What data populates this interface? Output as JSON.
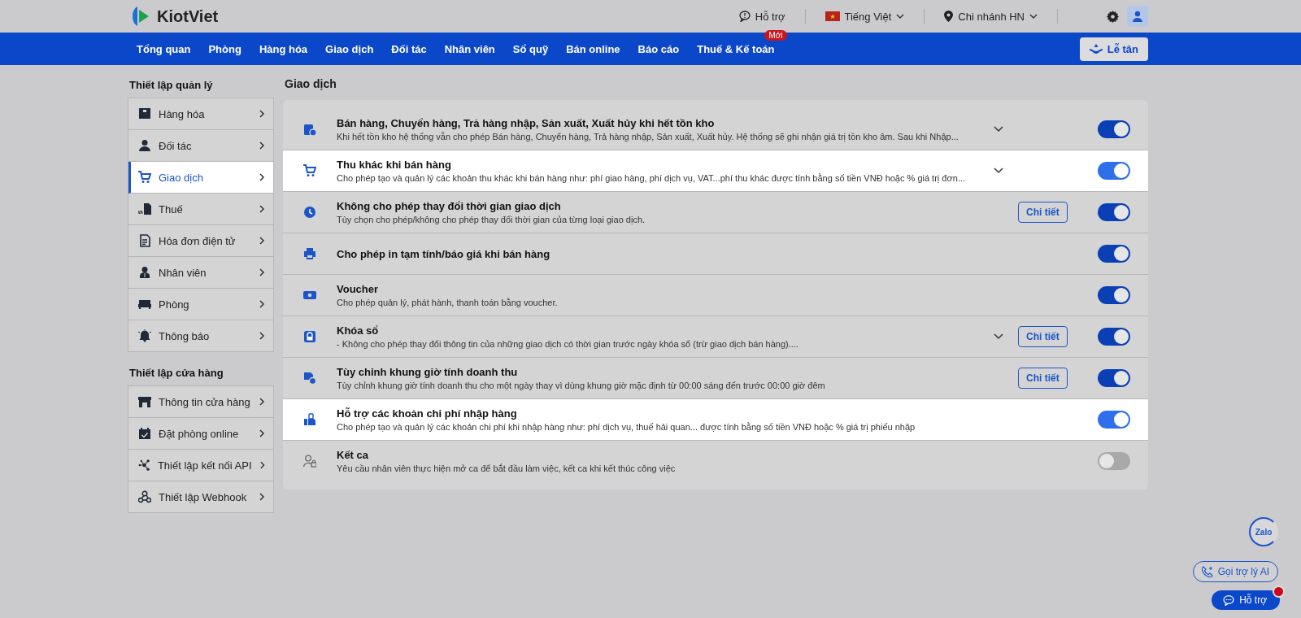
{
  "header": {
    "logo": "KiotViet",
    "support": "Hỗ trợ",
    "language": "Tiếng Việt",
    "branch": "Chi nhánh HN"
  },
  "nav": {
    "items": [
      {
        "label": "Tổng quan"
      },
      {
        "label": "Phòng"
      },
      {
        "label": "Hàng hóa"
      },
      {
        "label": "Giao dịch"
      },
      {
        "label": "Đối tác"
      },
      {
        "label": "Nhân viên"
      },
      {
        "label": "Sổ quỹ"
      },
      {
        "label": "Bán online"
      },
      {
        "label": "Báo cáo"
      },
      {
        "label": "Thuế & Kế toán",
        "badge": "Mới"
      }
    ],
    "reception_button": "Lễ tân"
  },
  "sidebar": {
    "groups": [
      {
        "title": "Thiết lập quản lý",
        "items": [
          {
            "label": "Hàng hóa",
            "selected": false
          },
          {
            "label": "Đối tác",
            "selected": false
          },
          {
            "label": "Giao dịch",
            "selected": true
          },
          {
            "label": "Thuế",
            "selected": false
          },
          {
            "label": "Hóa đơn điện tử",
            "selected": false
          },
          {
            "label": "Nhân viên",
            "selected": false
          },
          {
            "label": "Phòng",
            "selected": false
          },
          {
            "label": "Thông báo",
            "selected": false
          }
        ]
      },
      {
        "title": "Thiết lập cửa hàng",
        "items": [
          {
            "label": "Thông tin cửa hàng",
            "selected": false
          },
          {
            "label": "Đặt phòng online",
            "selected": false
          },
          {
            "label": "Thiết lập kết nối API",
            "selected": false
          },
          {
            "label": "Thiết lập Webhook",
            "selected": false
          }
        ]
      }
    ]
  },
  "settings": {
    "title": "Giao dịch",
    "rows": [
      {
        "title": "Bán hàng, Chuyển hàng, Trả hàng nhập, Sản xuất, Xuất hủy khi hết tồn kho",
        "description": "Khi hết tồn kho hệ thống vẫn cho phép Bán hàng, Chuyển hàng, Trả hàng nhập, Sản xuất, Xuất hủy. Hệ thống sẽ ghi nhận giá trị tồn kho âm. Sau khi Nhập...",
        "expandable": true,
        "on": true,
        "highlighted": false
      },
      {
        "title": "Thu khác khi bán hàng",
        "description": "Cho phép tạo và quản lý các khoản thu khác khi bán hàng như: phí giao hàng, phí dịch vụ, VAT...phí thu khác được tính bằng số tiền VNĐ hoặc % giá trị đơn...",
        "expandable": true,
        "on": true,
        "highlighted": true
      },
      {
        "title": "Không cho phép thay đổi thời gian giao dịch",
        "description": "Tùy chọn cho phép/không cho phép thay đổi thời gian của từng loại giao dịch.",
        "expandable": false,
        "detail_button": "Chi tiết",
        "on": true,
        "highlighted": false
      },
      {
        "title": "Cho phép in tạm tính/báo giá khi bán hàng",
        "expandable": false,
        "on": true,
        "highlighted": false
      },
      {
        "title": "Voucher",
        "description": "Cho phép quản lý, phát hành, thanh toán bằng voucher.",
        "expandable": false,
        "on": true,
        "highlighted": false
      },
      {
        "title": "Khóa sổ",
        "description": "- Không cho phép thay đổi thông tin của những giao dịch có thời gian trước ngày khóa sổ (trừ giao dịch bán hàng)....",
        "expandable": true,
        "detail_button": "Chi tiết",
        "on": true,
        "highlighted": false
      },
      {
        "title": "Tùy chỉnh khung giờ tính doanh thu",
        "description": "Tùy chỉnh khung giờ tính doanh thu cho một ngày thay vì dùng khung giờ mặc định từ 00:00 sáng đến trước 00:00 giờ đêm",
        "expandable": false,
        "detail_button": "Chi tiết",
        "on": true,
        "highlighted": false
      },
      {
        "title": "Hỗ trợ các khoản chi phí nhập hàng",
        "description": "Cho phép tạo và quản lý các khoản chi phí khi nhập hàng như: phí dịch vụ, thuế hải quan... được tính bằng số tiền VNĐ hoặc % giá trị phiếu nhập",
        "expandable": false,
        "on": true,
        "highlighted": true
      },
      {
        "title": "Kết ca",
        "description": "Yêu cầu nhân viên thực hiện mở ca để bắt đầu làm việc, kết ca khi kết thúc công việc",
        "expandable": false,
        "on": false,
        "highlighted": false
      }
    ]
  },
  "floating": {
    "zalo": "Zalo",
    "ai_button": "Gọi trợ lý AI",
    "support_button": "Hỗ trợ"
  }
}
